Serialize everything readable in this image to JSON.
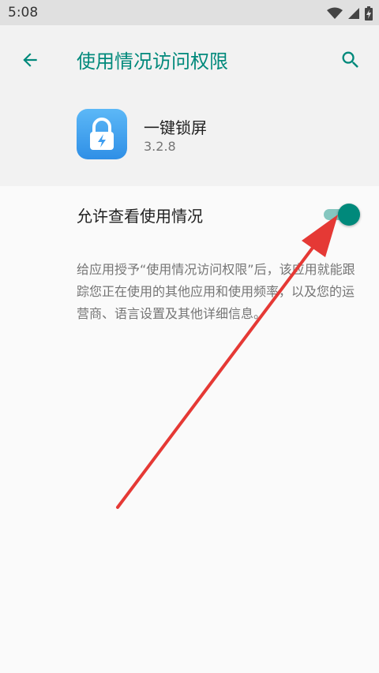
{
  "status_bar": {
    "time": "5:08",
    "icons": [
      "wifi-icon",
      "signal-icon",
      "battery-charging-icon"
    ]
  },
  "header": {
    "back_icon": "arrow-back-icon",
    "title": "使用情况访问权限",
    "search_icon": "search-icon"
  },
  "app": {
    "icon": "lock-icon",
    "name": "一键锁屏",
    "version": "3.2.8"
  },
  "preference": {
    "label": "允许查看使用情况",
    "enabled": true,
    "summary": "给应用授予“使用情况访问权限”后，该应用就能跟踪您正在使用的其他应用和使用频率，以及您的运营商、语言设置及其他详细信息。"
  },
  "annotation": {
    "type": "red-arrow",
    "points_to": "toggle-switch"
  },
  "colors": {
    "accent": "#00897b",
    "toggle_track": "#85c6bf",
    "app_icon": "#3d9df0",
    "arrow": "#e53935"
  }
}
